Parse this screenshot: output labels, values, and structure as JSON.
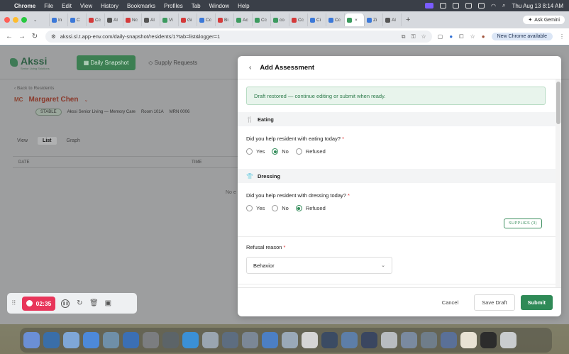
{
  "menubar": {
    "items": [
      "Chrome",
      "File",
      "Edit",
      "View",
      "History",
      "Bookmarks",
      "Profiles",
      "Tab",
      "Window",
      "Help"
    ],
    "datetime": "Thu Aug 13  8:14 AM"
  },
  "browser": {
    "tabs": [
      {
        "label": "In",
        "color": "#3b78d8"
      },
      {
        "label": "C",
        "color": "#3b78d8"
      },
      {
        "label": "Cc",
        "color": "#d43a3a"
      },
      {
        "label": "Al",
        "color": "#555555"
      },
      {
        "label": "Nc",
        "color": "#d43a3a"
      },
      {
        "label": "Al",
        "color": "#555555"
      },
      {
        "label": "Vi",
        "color": "#3c9a5f"
      },
      {
        "label": "Gi",
        "color": "#d43a3a"
      },
      {
        "label": "Cc",
        "color": "#3b78d8"
      },
      {
        "label": "Bi",
        "color": "#d43a3a"
      },
      {
        "label": "Ac",
        "color": "#3c9a5f"
      },
      {
        "label": "Cc",
        "color": "#3c9a5f"
      },
      {
        "label": "co",
        "color": "#3c9a5f"
      },
      {
        "label": "Cc",
        "color": "#d43a3a"
      },
      {
        "label": "Ci",
        "color": "#3b78d8"
      },
      {
        "label": "Cc",
        "color": "#3b78d8"
      },
      {
        "label": "",
        "color": "#3c9a5f",
        "active": true
      },
      {
        "label": "Zi",
        "color": "#3b78d8"
      },
      {
        "label": "Al",
        "color": "#555555"
      }
    ],
    "ask_gemini": "Ask Gemini",
    "url": "akssi.sl.t.app-env.com/daily-snapshot/residents/1?tab=list&logger=1",
    "new_chrome": "New Chrome available"
  },
  "app": {
    "logo": "Akssi",
    "logo_sub": "Senior Living Solutions",
    "nav": {
      "daily_snapshot": "Daily Snapshot",
      "supply_requests": "Supply Requests"
    },
    "breadcrumb": "‹  Back to Residents",
    "resident": {
      "initials": "MC",
      "name": "Margaret Chen",
      "status": "STABLE",
      "facility": "Akssi Senior Living — Memory Care",
      "room": "Room 101A",
      "mrn": "MRN 0006"
    },
    "view_label": "View",
    "view_tabs": [
      "List",
      "Graph"
    ],
    "table_headers": [
      "DATE",
      "TIME"
    ],
    "empty_text": "No e"
  },
  "recorder": {
    "timer": "02:35"
  },
  "modal": {
    "title": "Add Assessment",
    "alert": "Draft restored — continue editing or submit when ready.",
    "sections": [
      {
        "title": "Eating",
        "question": "Did you help resident with eating today?",
        "options": [
          "Yes",
          "No",
          "Refused"
        ],
        "selected": "No"
      },
      {
        "title": "Dressing",
        "question": "Did you help resident with dressing today?",
        "options": [
          "Yes",
          "No",
          "Refused"
        ],
        "selected": "Refused"
      }
    ],
    "supplies_button": "SUPPLIES (3)",
    "refusal_label": "Refusal reason",
    "refusal_value": "Behavior",
    "cancel": "Cancel",
    "save_draft": "Save Draft",
    "submit": "Submit"
  },
  "dock_colors": [
    "#6b8fd6",
    "#3a6ea8",
    "#7fa7d8",
    "#4d89d9",
    "#6f8fa8",
    "#3b6fb4",
    "#7b7d80",
    "#5c6468",
    "#3b90d6",
    "#9aa5b0",
    "#5d6d80",
    "#7b8796",
    "#4c7fc4",
    "#9aa9b8",
    "#d5d5d5",
    "#3b4b63",
    "#5d7ea8",
    "#3a4660",
    "#b8bcc0",
    "#7a8aa0",
    "#6f7d8a",
    "#5a7098",
    "#e8e2d4",
    "#2c2c2c",
    "#c9ccce"
  ]
}
